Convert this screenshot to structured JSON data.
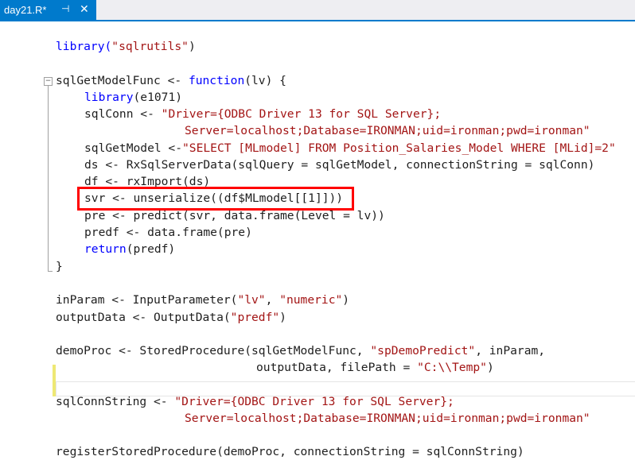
{
  "tab": {
    "title": "day21.R*",
    "pin_glyph": "⊣",
    "close_glyph": "✕"
  },
  "editor": {
    "fold_glyph": "−",
    "code": {
      "l1": [
        "library(",
        "\"sqlrutils\"",
        ")"
      ],
      "l2": [
        "sqlGetModelFunc <- ",
        "function",
        "(lv) {"
      ],
      "l3": [
        "library",
        "(e1071)"
      ],
      "l4": [
        "sqlConn <- ",
        "\"Driver={ODBC Driver 13 for SQL Server};"
      ],
      "l5": [
        "Server=localhost;Database=IRONMAN;uid=ironman;pwd=ironman\""
      ],
      "l6": [
        "sqlGetModel <-",
        "\"SELECT [MLmodel] FROM Position_Salaries_Model WHERE [MLid]=2\""
      ],
      "l7": [
        "ds <- RxSqlServerData(sqlQuery = sqlGetModel, connectionString = sqlConn)"
      ],
      "l8": [
        "df <- rxImport(ds)"
      ],
      "l9": [
        "svr <- unserialize((df$MLmodel[[1]]))"
      ],
      "l10": [
        "pre <- predict(svr, data.frame(Level = lv))"
      ],
      "l11": [
        "predf <- data.frame(pre)"
      ],
      "l12": [
        "return",
        "(predf)"
      ],
      "l13": [
        "}"
      ],
      "l14": [
        "inParam <- InputParameter(",
        "\"lv\"",
        ", ",
        "\"numeric\"",
        ")"
      ],
      "l15": [
        "outputData <- OutputData(",
        "\"predf\"",
        ")"
      ],
      "l16": [
        "demoProc <- StoredProcedure(sqlGetModelFunc, ",
        "\"spDemoPredict\"",
        ", inParam,"
      ],
      "l17": [
        "outputData, filePath = ",
        "\"C:\\\\Temp\"",
        ")"
      ],
      "l18": [
        "sqlConnString <- ",
        "\"Driver={ODBC Driver 13 for SQL Server};"
      ],
      "l19": [
        "Server=localhost;Database=IRONMAN;uid=ironman;pwd=ironman\""
      ],
      "l20": [
        "registerStoredProcedure(demoProc, connectionString = sqlConnString)"
      ]
    }
  },
  "colors": {
    "keyword": "#0000ff",
    "string": "#a31515",
    "text": "#1e1e1e",
    "tab_active": "#007acc",
    "annotation": "#ff0000"
  }
}
